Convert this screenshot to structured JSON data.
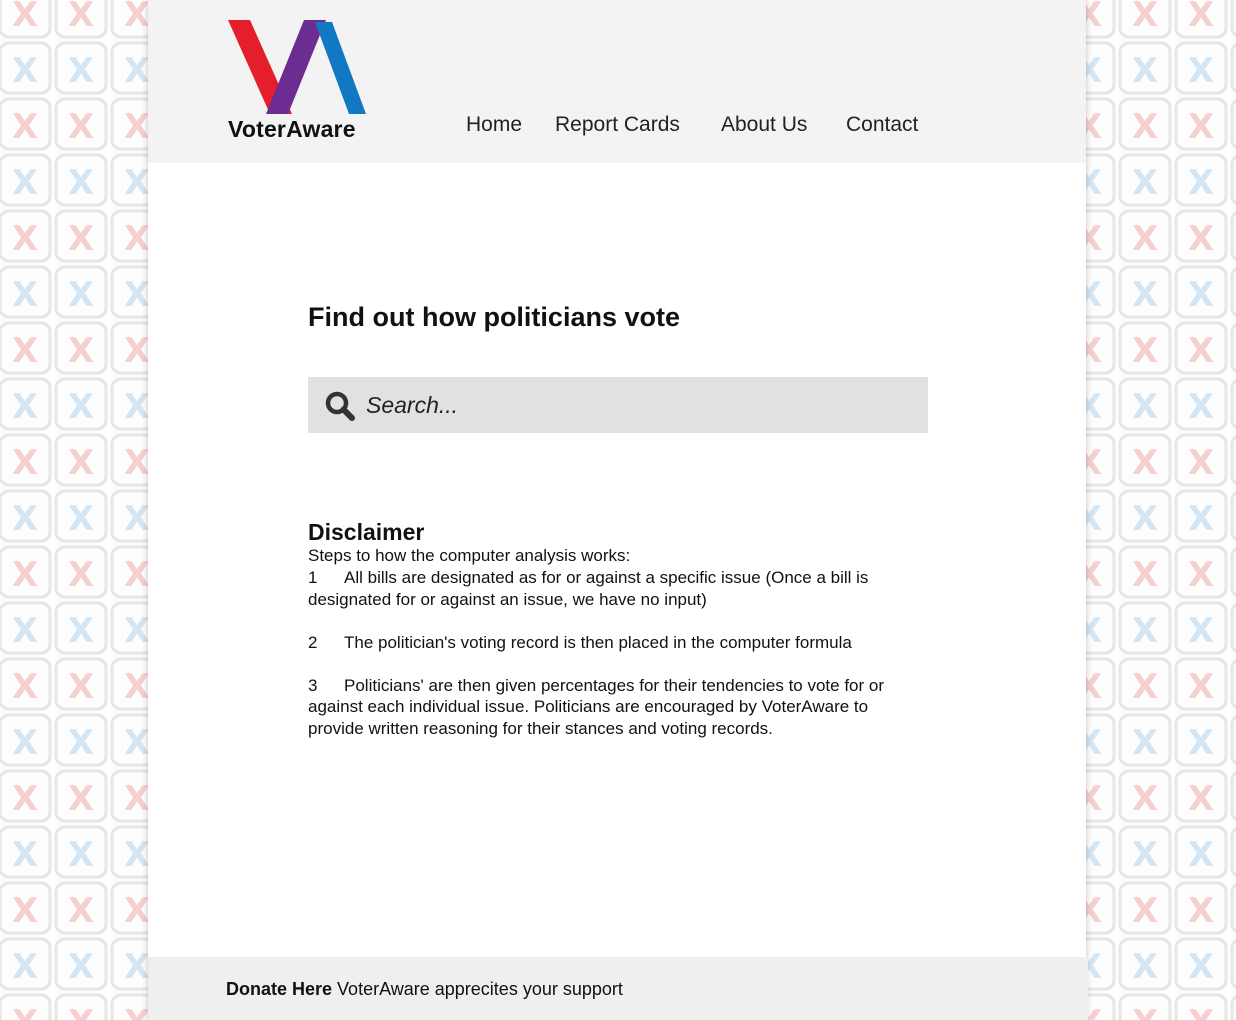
{
  "brand": {
    "name": "VoterAware",
    "colors": {
      "red": "#e41e2b",
      "purple": "#6b2d91",
      "blue": "#1378c4"
    }
  },
  "nav": {
    "items": [
      {
        "label": "Home"
      },
      {
        "label": "Report Cards"
      },
      {
        "label": "About Us"
      },
      {
        "label": "Contact"
      }
    ]
  },
  "main": {
    "headline": "Find out how politicians vote",
    "search": {
      "placeholder": "Search...",
      "value": "",
      "icon": "search-icon"
    }
  },
  "disclaimer": {
    "title": "Disclaimer",
    "intro": "Steps to how the computer analysis works:",
    "steps": [
      {
        "number": "1",
        "text": "All bills are designated as for or against a specific issue (Once a bill is designated for or against an issue, we have no input)"
      },
      {
        "number": "2",
        "text": "The politician's voting record is then placed in the computer formula"
      },
      {
        "number": "3",
        "text": "Politicians' are then given percentages for their tendencies to vote for or against each individual issue. Politicians are encouraged by VoterAware to provide written reasoning for their stances and voting records."
      }
    ]
  },
  "footer": {
    "donate_label": "Donate Here",
    "support_text": "VoterAware apprecites your support"
  }
}
